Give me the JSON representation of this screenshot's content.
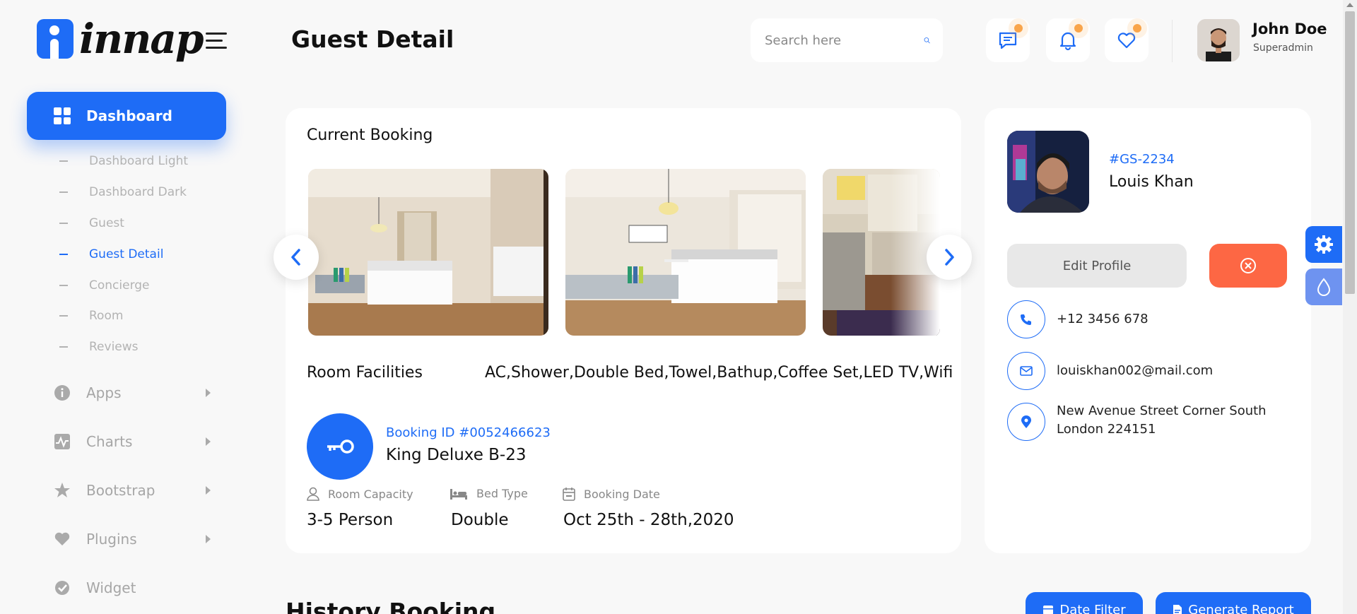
{
  "app": {
    "logo_text": "innap"
  },
  "header": {
    "title": "Guest Detail",
    "search_placeholder": "Search here",
    "user": {
      "name": "John Doe",
      "role": "Superadmin"
    }
  },
  "sidebar": {
    "dashboard_label": "Dashboard",
    "sub_items": [
      {
        "label": "Dashboard Light"
      },
      {
        "label": "Dashboard Dark"
      },
      {
        "label": "Guest"
      },
      {
        "label": "Guest Detail"
      },
      {
        "label": "Concierge"
      },
      {
        "label": "Room"
      },
      {
        "label": "Reviews"
      }
    ],
    "menus": [
      {
        "label": "Apps",
        "icon": "info-icon"
      },
      {
        "label": "Charts",
        "icon": "chart-icon"
      },
      {
        "label": "Bootstrap",
        "icon": "star-icon"
      },
      {
        "label": "Plugins",
        "icon": "heart-icon"
      },
      {
        "label": "Widget",
        "icon": "widget-icon"
      }
    ]
  },
  "booking": {
    "card_title": "Current Booking",
    "facilities_label": "Room Facilities",
    "facilities_value": "AC,Shower,Double Bed,Towel,Bathup,Coffee Set,LED TV,Wifi",
    "booking_id": "Booking ID #0052466623",
    "room_name": "King Deluxe B-23",
    "specs": [
      {
        "label": "Room Capacity",
        "value": "3-5 Person"
      },
      {
        "label": "Bed Type",
        "value": "Double"
      },
      {
        "label": "Booking Date",
        "value": "Oct 25th - 28th,2020"
      }
    ]
  },
  "guest": {
    "id": "#GS-2234",
    "name": "Louis Khan",
    "edit_label": "Edit Profile",
    "phone": "+12 3456 678",
    "email": "louiskhan002@mail.com",
    "address": "New Avenue Street Corner South London 224151"
  },
  "history": {
    "title": "History Booking",
    "date_filter_label": "Date Filter",
    "generate_report_label": "Generate Report"
  },
  "colors": {
    "accent": "#1e6cf6",
    "danger": "#fd6744",
    "badge": "#f9a54b"
  }
}
